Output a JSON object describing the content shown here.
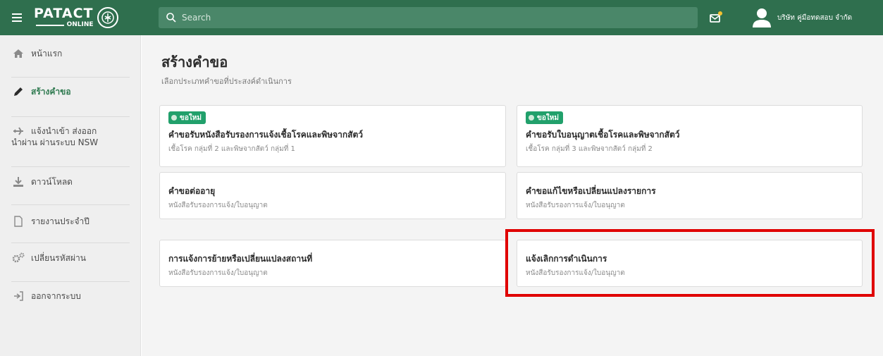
{
  "header": {
    "logo_main": "PATACT",
    "logo_sub": "ONLINE",
    "search_placeholder": "Search",
    "username": "บริษัท คู่มือทดสอบ จำกัด"
  },
  "sidebar": {
    "items": [
      {
        "label": "หน้าแรก",
        "icon": "home-icon"
      },
      {
        "label": "สร้างคำขอ",
        "icon": "pencil-icon",
        "active": true
      },
      {
        "label_line1": "แจ้งนำเข้า ส่งออก",
        "label_line2": "นำผ่าน ผ่านระบบ NSW",
        "icon": "airplane-icon"
      },
      {
        "label": "ดาวน์โหลด",
        "icon": "download-icon"
      },
      {
        "label": "รายงานประจำปี",
        "icon": "file-icon"
      },
      {
        "label": "เปลี่ยนรหัสผ่าน",
        "icon": "gears-icon"
      },
      {
        "label": "ออกจากระบบ",
        "icon": "logout-icon"
      }
    ]
  },
  "main": {
    "title": "สร้างคำขอ",
    "subtitle": "เลือกประเภทคำขอที่ประสงค์ดำเนินการ",
    "cards": [
      {
        "badge": "ขอใหม่",
        "title": "คำขอรับหนังสือรับรองการแจ้งเชื้อโรคและพิษจากสัตว์",
        "desc": "เชื้อโรค กลุ่มที่ 2 และพิษจากสัตว์ กลุ่มที่ 1"
      },
      {
        "badge": "ขอใหม่",
        "title": "คำขอรับใบอนุญาตเชื้อโรคและพิษจากสัตว์",
        "desc": "เชื้อโรค กลุ่มที่ 3 และพิษจากสัตว์ กลุ่มที่ 2"
      },
      {
        "title": "คำขอต่ออายุ",
        "desc": "หนังสือรับรองการแจ้ง/ใบอนุญาต"
      },
      {
        "title": "คำขอแก้ไขหรือเปลี่ยนแปลงรายการ",
        "desc": "หนังสือรับรองการแจ้ง/ใบอนุญาต"
      },
      {
        "title": "การแจ้งการย้ายหรือเปลี่ยนแปลงสถานที่",
        "desc": "หนังสือรับรองการแจ้ง/ใบอนุญาต"
      },
      {
        "title": "แจ้งเลิกการดำเนินการ",
        "desc": "หนังสือรับรองการแจ้ง/ใบอนุญาต"
      }
    ]
  },
  "colors": {
    "topbar": "#2f6f4e",
    "accent": "#2f7a50",
    "badge": "#21a06b",
    "highlight": "#e00000"
  }
}
